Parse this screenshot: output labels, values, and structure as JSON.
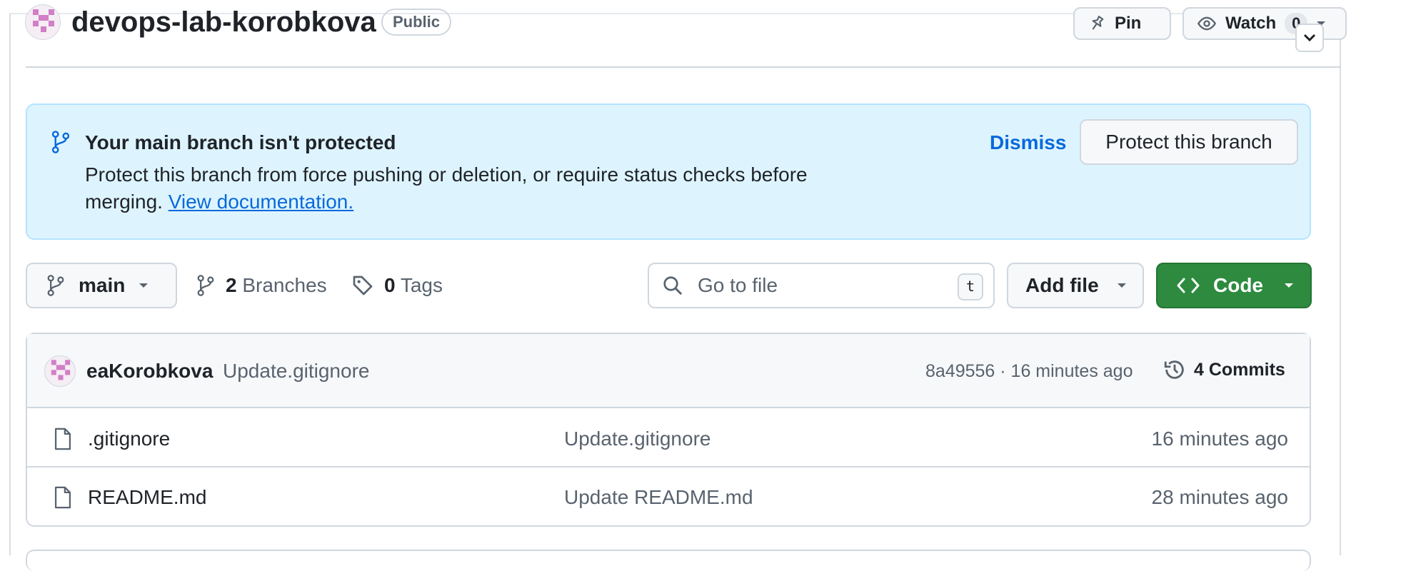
{
  "repo": {
    "name": "devops-lab-korobkova",
    "visibility": "Public",
    "pin_label": "Pin",
    "watch_label": "Watch",
    "watch_count": "0"
  },
  "banner": {
    "title": "Your main branch isn't protected",
    "text": "Protect this branch from force pushing or deletion, or require status checks before merging.",
    "link": "View documentation.",
    "dismiss": "Dismiss",
    "protect_button": "Protect this branch"
  },
  "toolbar": {
    "branch": "main",
    "branches_count": "2",
    "branches_label": "Branches",
    "tags_count": "0",
    "tags_label": "Tags",
    "search_placeholder": "Go to file",
    "search_shortcut": "t",
    "add_file": "Add file",
    "code": "Code"
  },
  "latest_commit": {
    "author": "eaKorobkova",
    "message": "Update.gitignore",
    "meta": "8a49556 · 16 minutes ago",
    "commits_label": "4 Commits"
  },
  "files": [
    {
      "name": ".gitignore",
      "message": "Update.gitignore",
      "time": "16 minutes ago"
    },
    {
      "name": "README.md",
      "message": "Update README.md",
      "time": "28 minutes ago"
    }
  ],
  "colors": {
    "banner_bg": "#ddf4ff",
    "code_button": "#2d8a3e",
    "link": "#0969da",
    "avatar_accent": "#d17fc6"
  }
}
